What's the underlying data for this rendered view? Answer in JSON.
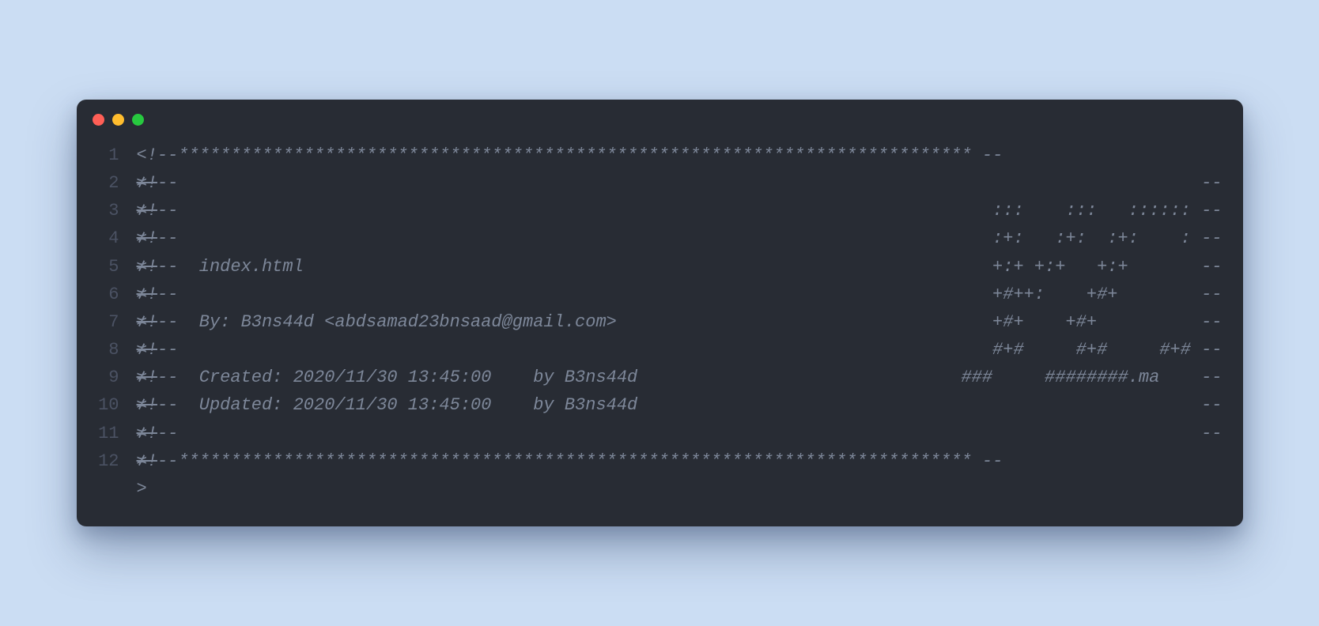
{
  "window": {
    "traffic_lights": [
      "close",
      "minimize",
      "zoom"
    ]
  },
  "editor": {
    "lines": [
      {
        "num": "1",
        "prefix": "<!",
        "left": "--**************************************************************************** --",
        "right": ""
      },
      {
        "num": "2",
        "prefix": "≭!",
        "left": "--",
        "right": "--"
      },
      {
        "num": "3",
        "prefix": "≭!",
        "left": "--",
        "right": ":::    :::   :::::: --"
      },
      {
        "num": "4",
        "prefix": "≭!",
        "left": "--",
        "right": ":+:   :+:  :+:    : --"
      },
      {
        "num": "5",
        "prefix": "≭!",
        "left": "--  index.html",
        "right": "+:+ +:+   +:+       --"
      },
      {
        "num": "6",
        "prefix": "≭!",
        "left": "--",
        "right": "+#++:    +#+        --"
      },
      {
        "num": "7",
        "prefix": "≭!",
        "left": "--  By: B3ns44d <abdsamad23bnsaad@gmail.com>",
        "right": "+#+    +#+          --"
      },
      {
        "num": "8",
        "prefix": "≭!",
        "left": "--",
        "right": "#+#     #+#     #+# --"
      },
      {
        "num": "9",
        "prefix": "≭!",
        "left": "--  Created: 2020/11/30 13:45:00    by B3ns44d",
        "right": "###     ########.ma    --"
      },
      {
        "num": "10",
        "prefix": "≭!",
        "left": "--  Updated: 2020/11/30 13:45:00    by B3ns44d",
        "right": "--"
      },
      {
        "num": "11",
        "prefix": "≭!",
        "left": "--",
        "right": "--"
      },
      {
        "num": "12",
        "prefix": "≭!",
        "left": "--**************************************************************************** --",
        "right": ""
      }
    ],
    "continuation": ">"
  }
}
